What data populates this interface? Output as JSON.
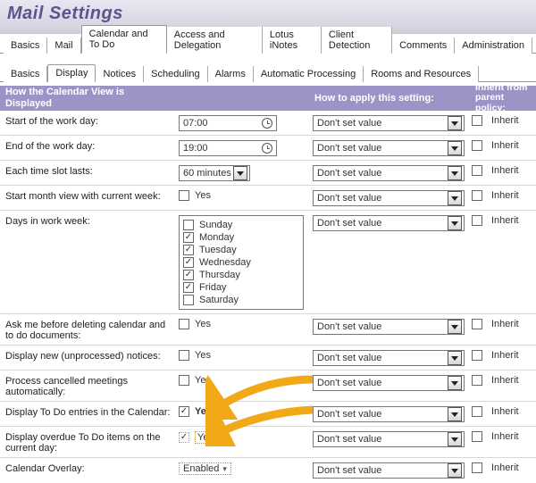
{
  "page_title": "Mail Settings",
  "primary_tabs": [
    "Basics",
    "Mail",
    "Calendar and To Do",
    "Access and Delegation",
    "Lotus iNotes",
    "Client Detection",
    "Comments",
    "Administration"
  ],
  "primary_active": 2,
  "secondary_tabs": [
    "Basics",
    "Display",
    "Notices",
    "Scheduling",
    "Alarms",
    "Automatic Processing",
    "Rooms and Resources"
  ],
  "secondary_active": 1,
  "section": {
    "col1": "How the Calendar View is Displayed",
    "col3": "How to apply this setting:",
    "col4": "Inherit from parent policy:"
  },
  "apply_default": "Don't set value",
  "inherit_label": "Inherit",
  "yes_label": "Yes",
  "rows": {
    "start_day": {
      "label": "Start of the work day:",
      "value": "07:00"
    },
    "end_day": {
      "label": "End of the work day:",
      "value": "19:00"
    },
    "slot": {
      "label": "Each time slot lasts:",
      "value": "60 minutes"
    },
    "start_month": {
      "label": "Start month view with current week:",
      "checked": false
    },
    "work_week": {
      "label": "Days in work week:",
      "days": [
        {
          "name": "Sunday",
          "checked": false
        },
        {
          "name": "Monday",
          "checked": true
        },
        {
          "name": "Tuesday",
          "checked": true
        },
        {
          "name": "Wednesday",
          "checked": true
        },
        {
          "name": "Thursday",
          "checked": true
        },
        {
          "name": "Friday",
          "checked": true
        },
        {
          "name": "Saturday",
          "checked": false
        }
      ]
    },
    "ask_delete": {
      "label": "Ask me before deleting calendar and to do documents:",
      "checked": false
    },
    "disp_new": {
      "label": "Display new (unprocessed) notices:",
      "checked": false
    },
    "proc_cancel": {
      "label": "Process cancelled meetings automatically:",
      "checked": false
    },
    "disp_todo": {
      "label": "Display To Do entries in the Calendar:",
      "checked": true
    },
    "disp_overdue": {
      "label": "Display overdue To Do items on the current day:",
      "checked": true,
      "yes_dotted": true
    },
    "overlay": {
      "label": "Calendar Overlay:",
      "value": "Enabled"
    }
  }
}
